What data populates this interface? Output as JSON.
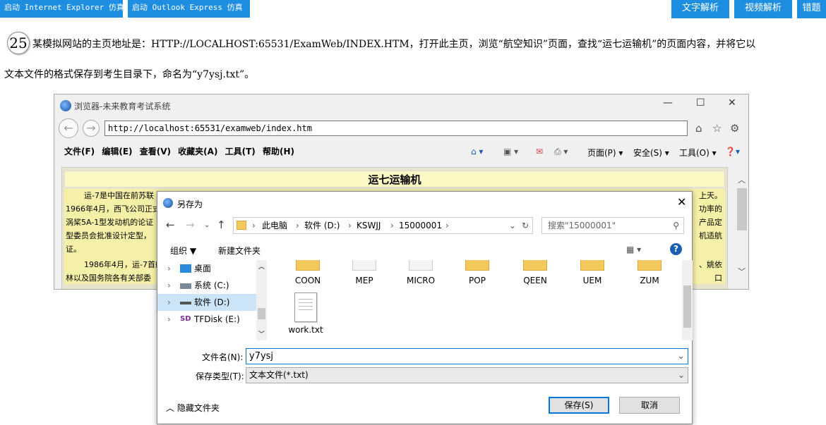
{
  "top_buttons": {
    "ie": "启动 Internet Explorer 仿真",
    "outlook": "启动 Outlook Express 仿真",
    "text_analysis": "文字解析",
    "video_analysis": "视频解析",
    "wrong_q": "错题"
  },
  "question": {
    "number": "25",
    "line1": "某模拟网站的主页地址是：HTTP://LOCALHOST:65531/ExamWeb/INDEX.HTM，打开此主页，浏览“航空知识”页面，查找“运七运输机”的页面内容，并将它以",
    "line2": "文本文件的格式保存到考生目录下，命名为“y7ysj.txt”。"
  },
  "browser": {
    "title": "浏览器-未来教育考试系统",
    "address": "http://localhost:65531/examweb/index.htm",
    "menu": [
      "文件(F)",
      "编辑(E)",
      "查看(V)",
      "收藏夹(A)",
      "工具(T)",
      "帮助(H)"
    ],
    "tools": {
      "page": "页面(P)",
      "safety": "安全(S)",
      "tool": "工具(O)"
    },
    "page_title": "运七运输机",
    "para_a": "运-7是中国在前苏联",
    "para_a_end": "上天。",
    "para_b": "1966年4月，西飞公司正式",
    "para_b_end": "功率的",
    "para_c": "涡桨5A-1型发动机的论证",
    "para_c_end": "产品定",
    "para_d": "型委员会批准设计定型，",
    "para_d_end": "机适航",
    "para_e": "证。",
    "para_f": "1986年4月，运-7首航",
    "para_f_end": "、姚依",
    "para_g": "林以及国务院各有关部委",
    "para_g_end": "口"
  },
  "dialog": {
    "title": "另存为",
    "path": [
      "此电脑",
      "软件 (D:)",
      "KSWJJ",
      "15000001"
    ],
    "search_placeholder": "搜索\"15000001\"",
    "organize": "组织 ▼",
    "new_folder": "新建文件夹",
    "tree": [
      "桌面",
      "系统 (C:)",
      "软件 (D:)",
      "TFDisk (E:)"
    ],
    "folders": [
      "COON",
      "MEP",
      "MICRO",
      "POP",
      "QEEN",
      "UEM",
      "ZUM"
    ],
    "file": "work.txt",
    "filename_label": "文件名(N):",
    "filename_value": "y7ysj",
    "filetype_label": "保存类型(T):",
    "filetype_value": "文本文件(*.txt)",
    "hide_folders": "隐藏文件夹",
    "save": "保存(S)",
    "cancel": "取消"
  }
}
